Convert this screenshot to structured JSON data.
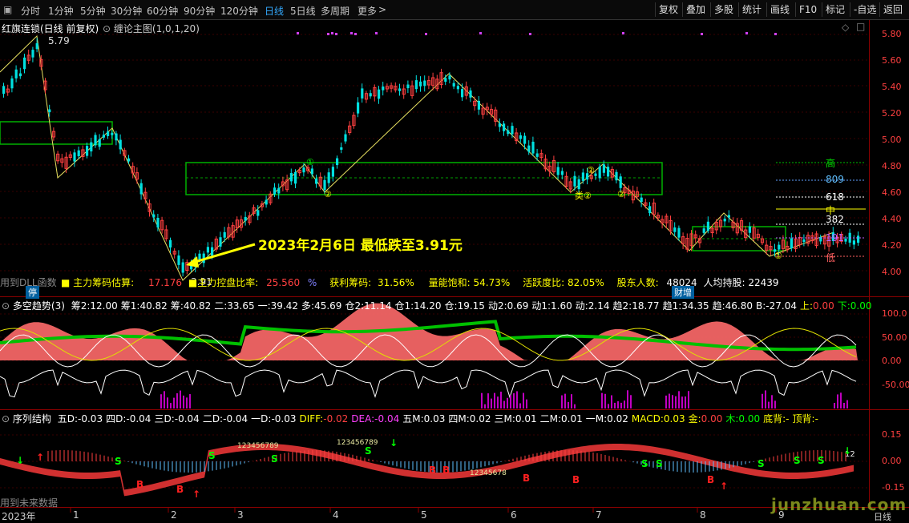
{
  "toolbar": {
    "left_tabs": [
      "分时",
      "1分钟",
      "5分钟",
      "30分钟",
      "60分钟",
      "90分钟",
      "120分钟",
      "日线",
      "5日线",
      "多周期",
      "更多"
    ],
    "active_tab": "日线",
    "right_buttons": [
      "复权",
      "叠加",
      "多股",
      "统计",
      "画线",
      "F10",
      "标记",
      "-自选",
      "返回"
    ]
  },
  "main_panel": {
    "title": "红旗连锁(日线 前复权)",
    "indicator": "缠论主图(1,0,1,20)",
    "high_label": "5.79",
    "low_label": "3.91",
    "annotation": "2023年2月6日 最低跌至3.91元",
    "right_levels": [
      "高",
      "809",
      "618",
      "中",
      "382",
      "191",
      "低"
    ],
    "stats": [
      {
        "label": "主力筹码估算:",
        "value": "17.176"
      },
      {
        "label": "主力控盘比率:",
        "value": "25.560",
        "unit": "%"
      },
      {
        "label": "获利筹码:",
        "value": "31.56%"
      },
      {
        "label": "量能饱和:",
        "value": "54.73%"
      },
      {
        "label": "活跃度比:",
        "value": "82.05%"
      },
      {
        "label": "股东人数:",
        "value": "48024"
      },
      {
        "label": "人均持股:",
        "value": "22439"
      }
    ],
    "left_note": "用到DLL函数",
    "tags": [
      "停",
      "财增"
    ],
    "point_markers": [
      "①",
      "②",
      "②",
      "②",
      "类②",
      "①"
    ],
    "y_ticks": [
      "5.80",
      "5.60",
      "5.40",
      "5.20",
      "5.00",
      "4.80",
      "4.60",
      "4.40",
      "4.20",
      "4.00"
    ]
  },
  "panel2": {
    "title": "多空趋势(3)",
    "stats": [
      {
        "label": "筹2:",
        "value": "12.00"
      },
      {
        "label": "筹1:",
        "value": "40.82"
      },
      {
        "label": "筹:",
        "value": "40.82"
      },
      {
        "label": "二:",
        "value": "33.65"
      },
      {
        "label": "一:",
        "value": "39.42"
      },
      {
        "label": "多:",
        "value": "45.69"
      },
      {
        "label": "仓2:",
        "value": "11.14"
      },
      {
        "label": "仓1:",
        "value": "14.20"
      },
      {
        "label": "仓:",
        "value": "19.15"
      },
      {
        "label": "动2:",
        "value": "0.69"
      },
      {
        "label": "动1:",
        "value": "1.60"
      },
      {
        "label": "动:",
        "value": "2.14"
      },
      {
        "label": "趋2:",
        "value": "18.77"
      },
      {
        "label": "趋1:",
        "value": "34.35"
      },
      {
        "label": "趋:",
        "value": "46.80"
      },
      {
        "label": "B:",
        "value": "-27.04"
      },
      {
        "label": "上:",
        "value": "0.00"
      },
      {
        "label": "下:",
        "value": "0.00"
      }
    ],
    "y_ticks": [
      "100.0",
      "50.00",
      "0.00",
      "-50.00"
    ]
  },
  "panel3": {
    "title": "序列结构",
    "stats": [
      {
        "label": "五D:",
        "value": "-0.03"
      },
      {
        "label": "四D:",
        "value": "-0.04"
      },
      {
        "label": "三D:",
        "value": "-0.04"
      },
      {
        "label": "二D:",
        "value": "-0.04"
      },
      {
        "label": "一D:",
        "value": "-0.03"
      },
      {
        "label": "DIFF:",
        "value": "-0.02"
      },
      {
        "label": "DEA:",
        "value": "-0.04"
      },
      {
        "label": "五M:",
        "value": "0.03"
      },
      {
        "label": "四M:",
        "value": "0.02"
      },
      {
        "label": "三M:",
        "value": "0.01"
      },
      {
        "label": "二M:",
        "value": "0.01"
      },
      {
        "label": "一M:",
        "value": "0.02"
      },
      {
        "label": "MACD:",
        "value": "0.03"
      },
      {
        "label": "金:",
        "value": "0.00"
      },
      {
        "label": "木:",
        "value": "0.00"
      },
      {
        "label": "底背:",
        "value": "-"
      },
      {
        "label": "顶背:",
        "value": "-"
      }
    ],
    "seq_labels": [
      "123456789",
      "123456789",
      "12345678",
      "12"
    ],
    "left_note": "用到未来数据",
    "y_ticks": [
      "0.15",
      "0.00",
      "-0.15"
    ]
  },
  "x_axis": {
    "year": "2023年",
    "months": [
      "1",
      "2",
      "3",
      "4",
      "5",
      "6",
      "7",
      "8",
      "9"
    ],
    "period_label": "日线"
  },
  "watermark": "junzhuan.com",
  "colors": {
    "up": "#ff4040",
    "down": "#00e0e0",
    "ma": "#ffff00",
    "zone": "#00a000",
    "grid": "#8b0000"
  }
}
